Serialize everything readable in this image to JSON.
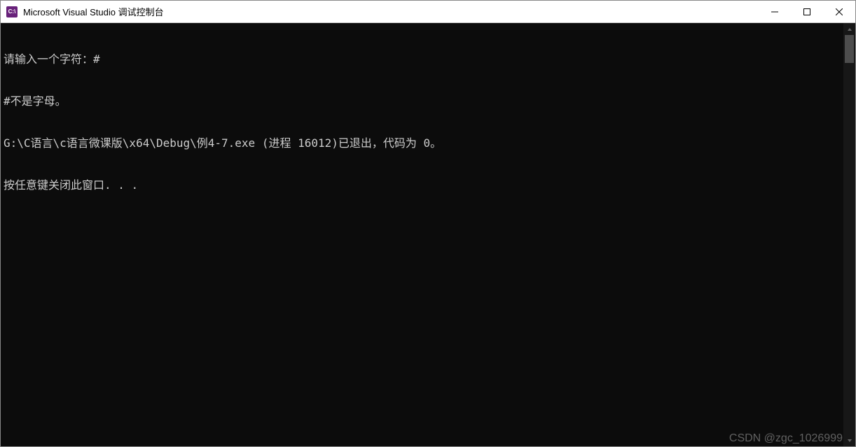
{
  "titlebar": {
    "icon_label": "C:\\",
    "title": "Microsoft Visual Studio 调试控制台"
  },
  "window_controls": {
    "minimize_name": "minimize",
    "maximize_name": "maximize",
    "close_name": "close"
  },
  "console": {
    "lines": [
      "请输入一个字符：#",
      "#不是字母。",
      "G:\\C语言\\c语言微课版\\x64\\Debug\\例4-7.exe (进程 16012)已退出，代码为 0。",
      "按任意键关闭此窗口. . ."
    ]
  },
  "watermark": "CSDN @zgc_1026999"
}
